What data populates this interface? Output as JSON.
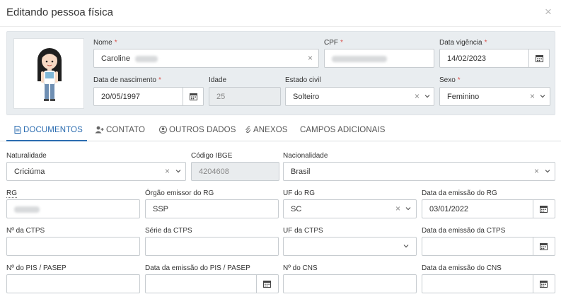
{
  "modal": {
    "title": "Editando pessoa física",
    "close": "×"
  },
  "person": {
    "nome_label": "Nome",
    "nome_value": "Caroline",
    "cpf_label": "CPF",
    "data_vigencia_label": "Data vigência",
    "data_vigencia_value": "14/02/2023",
    "nascimento_label": "Data de nascimento",
    "nascimento_value": "20/05/1997",
    "idade_label": "Idade",
    "idade_value": "25",
    "estado_civil_label": "Estado civil",
    "estado_civil_value": "Solteiro",
    "sexo_label": "Sexo",
    "sexo_value": "Feminino"
  },
  "tabs": [
    {
      "label": "DOCUMENTOS",
      "icon": "document-icon"
    },
    {
      "label": "CONTATO",
      "icon": "add-user-icon"
    },
    {
      "label": "OUTROS DADOS",
      "icon": "user-circle-icon"
    },
    {
      "label": "ANEXOS",
      "icon": "paperclip-icon"
    },
    {
      "label": "CAMPOS ADICIONAIS",
      "icon": ""
    }
  ],
  "docs": {
    "naturalidade_label": "Naturalidade",
    "naturalidade_value": "Criciúma",
    "ibge_label": "Código IBGE",
    "ibge_value": "4204608",
    "nacionalidade_label": "Nacionalidade",
    "nacionalidade_value": "Brasil",
    "rg_label": "RG",
    "orgao_label": "Órgão emissor do RG",
    "orgao_value": "SSP",
    "uf_rg_label": "UF do RG",
    "uf_rg_value": "SC",
    "emissao_rg_label": "Data da emissão do RG",
    "emissao_rg_value": "03/01/2022",
    "ctps_label": "Nº da CTPS",
    "serie_ctps_label": "Série da CTPS",
    "uf_ctps_label": "UF da CTPS",
    "emissao_ctps_label": "Data da emissão da CTPS",
    "pis_label": "Nº do PIS / PASEP",
    "emissao_pis_label": "Data da emissão do PIS / PASEP",
    "cns_label": "Nº do CNS",
    "emissao_cns_label": "Data da emissão do CNS"
  },
  "colors": {
    "accent": "#2b6cb0",
    "required": "#d9534f",
    "panel": "#e9edf0"
  }
}
